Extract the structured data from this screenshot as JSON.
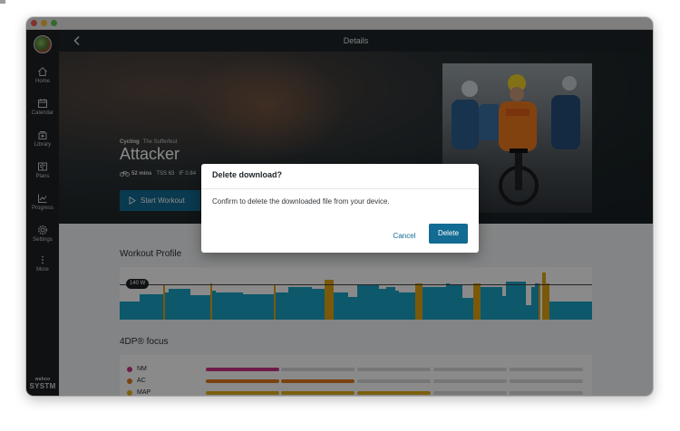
{
  "header": {
    "title": "Details"
  },
  "sidebar": {
    "items": [
      {
        "label": "Home",
        "icon": "home-icon"
      },
      {
        "label": "Calendar",
        "icon": "calendar-icon"
      },
      {
        "label": "Library",
        "icon": "library-icon"
      },
      {
        "label": "Plans",
        "icon": "plans-icon"
      },
      {
        "label": "Progress",
        "icon": "progress-icon"
      },
      {
        "label": "Settings",
        "icon": "gear-icon"
      },
      {
        "label": "More",
        "icon": "more-icon"
      }
    ],
    "brand_top": "wahoo",
    "brand_bottom": "SYSTM"
  },
  "workout": {
    "category": "Cycling",
    "provider": "The Sufferfest",
    "title": "Attacker",
    "duration": "52 mins",
    "tss": "TSS 63",
    "if": "IF 0.84",
    "start_label": "Start Workout"
  },
  "profile": {
    "title": "Workout Profile",
    "ftp_label": "140 W",
    "colors": {
      "base": "#1aa3c8",
      "interval": "#e2a516",
      "peak": "#e05a2a"
    }
  },
  "focus": {
    "title": "4DP® focus",
    "rows": [
      {
        "label": "NM",
        "color": "#c9348a",
        "level": 1
      },
      {
        "label": "AC",
        "color": "#e07a1f",
        "level": 2
      },
      {
        "label": "MAP",
        "color": "#e6b21a",
        "level": 3
      }
    ]
  },
  "dialog": {
    "title": "Delete download?",
    "body": "Confirm to delete the downloaded file from your device.",
    "cancel_label": "Cancel",
    "delete_label": "Delete"
  },
  "colors": {
    "accent": "#126b92",
    "sidebar": "#1c2124"
  }
}
